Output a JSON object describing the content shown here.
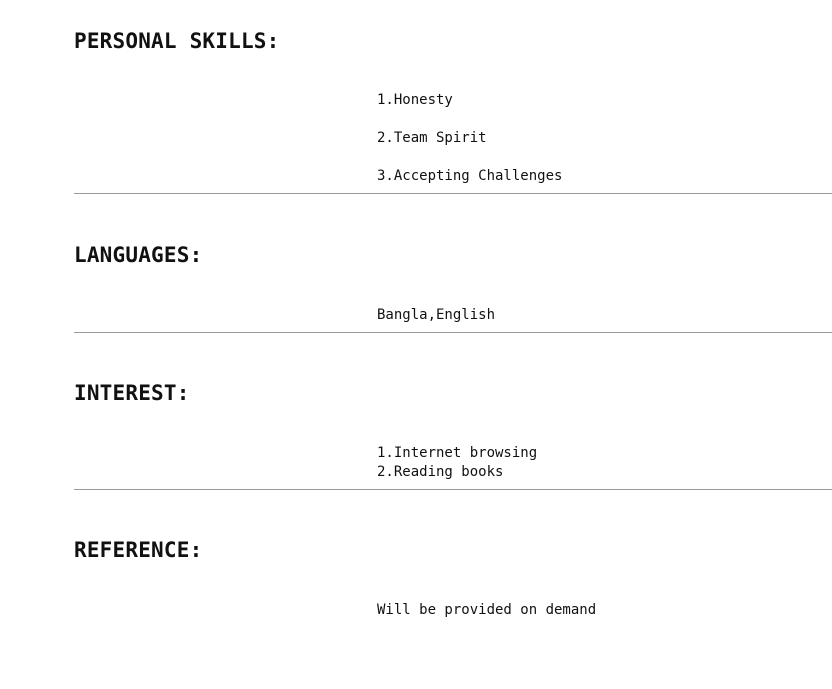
{
  "personal_skills": {
    "heading": "PERSONAL SKILLS:",
    "items": [
      "1.Honesty",
      "2.Team Spirit",
      "3.Accepting Challenges"
    ]
  },
  "languages": {
    "heading": "LANGUAGES:",
    "value": "Bangla,English"
  },
  "interest": {
    "heading": "INTEREST:",
    "items": [
      "1.Internet browsing",
      "2.Reading books"
    ]
  },
  "reference": {
    "heading": "REFERENCE:",
    "value": "Will be provided on demand"
  }
}
